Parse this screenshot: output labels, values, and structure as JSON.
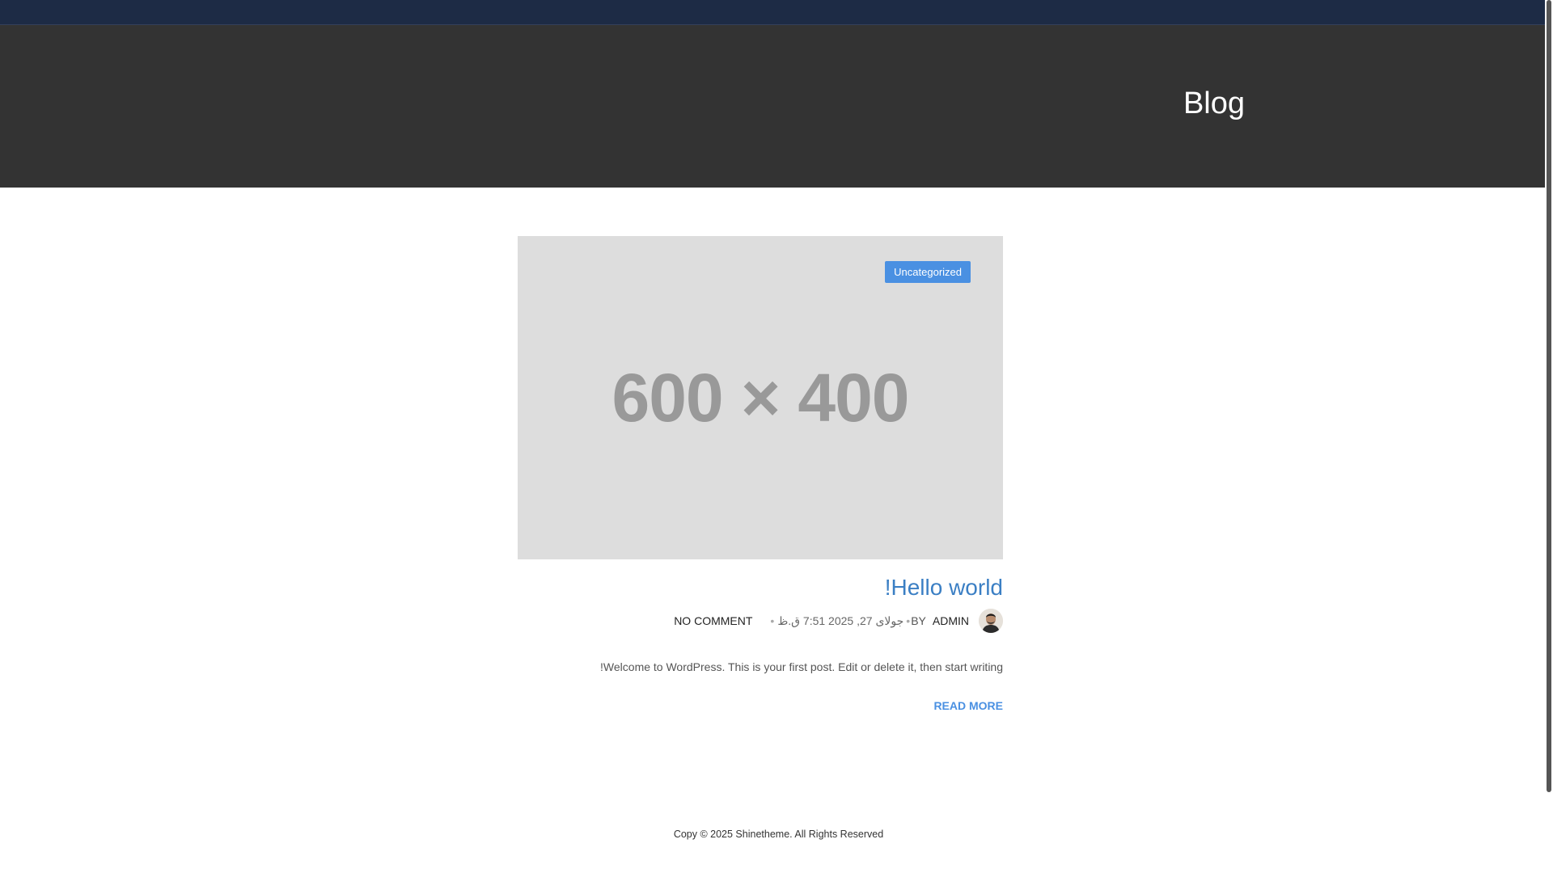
{
  "header": {
    "page_title": "Blog"
  },
  "post": {
    "category": "Uncategorized",
    "thumbnail_text": "600 × 400",
    "title": "!Hello world",
    "meta": {
      "author": "ADMIN",
      "by_label": "BY",
      "date": "جولای 27, 2025 7:51 ق.ظ",
      "comments": "NO COMMENT"
    },
    "excerpt": "!Welcome to WordPress. This is your first post. Edit or delete it, then start writing",
    "read_more": "READ MORE"
  },
  "footer": {
    "copyright": "Copy © 2025 Shinetheme. All Rights Reserved"
  },
  "colors": {
    "topbar": "#1d2b45",
    "hero": "#333333",
    "accent": "#4a90e2",
    "title_link": "#3b7fc4",
    "placeholder_bg": "#dddddd"
  }
}
